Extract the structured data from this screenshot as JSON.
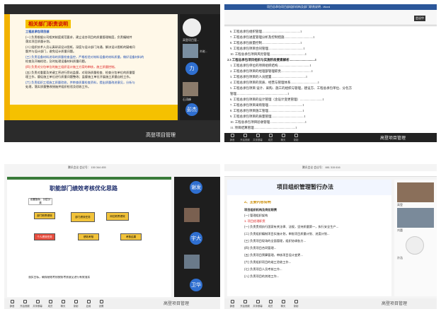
{
  "q1": {
    "title": "相关部门职责说明",
    "subtitle": "工程总承包项目部",
    "lines": [
      "(一) 负责根据公司相关制度规范要求，建立适合项目的质量管理制度，负责编制并",
      "落实项目质量计划。",
      "(二) 组织技术人员认真研读设计图纸，深度与设计部门沟通，解决设计图纸的疑难问",
      "题并与设计部门，避免设计质量问题。",
      "(三) 负责设备材料进场的质量检查监控，严格检验对材料设备的材料质量，做好设备材料的",
      "检查及开箱检验，及时处理设备材料质量问题。",
      "(四) 负责对分包单位的施工组织设计施工方案的审核，施工质量控制。",
      "(五) 负责对重要及关键工序进行旁站监督，对现场质量检查、检查分包单位的质量管",
      "理工作，督促施工单位进行质量问题整改；监督施工单位开展施工质量自检工作。",
      "(六) 负责组织工程施工质量验收，并审查质量检查资料，提出质量改进意见，分析与",
      "处理，落实质量整改措施并组织检验及验收工作。"
    ],
    "watermark": "高登项目管理",
    "side_labels": [
      "高登项目管...",
      "刘老...",
      "力",
      "石涛峰",
      "彭杰"
    ]
  },
  "q2": {
    "window_title": "项目总承包项目部组织机构及部门职责说明 - Word",
    "side_label": "会议中",
    "lines": [
      "6. 工程总承包组织管理................................................1",
      "7. 工程总承包进度管理分析及控制措施....................................1",
      "8. 工程总承包质量控制................................................1",
      "9. 工程总承包项目合同管理............................................1",
      "10. 工程总承包项目风险管理............................................1",
      "2.3 工程总承包项目组织与实施阶段要素解析................................1",
      "1. 工程总承包单位的项目组织结构........................................1",
      "2. 工程总承包项目的经理部管理职责......................................1",
      "3. 工程总承包项目的人员配置...........................................1",
      "4. 工程总承包项目的资质、经营与管理体系..................................1",
      "5. 工程总承包项目 设计、采购、施工的组织与管理，建设方、工程总承包单位、分包方",
      "管理................................................................1",
      "6. 工程总承包项目的设计管理（含设计变更管理）............................1",
      "7. 工程总承包项目采购管理...........................................1",
      "8. 工程总承包项目施工管理...........................................1",
      "9. 工程总承包项目的质量管理.........................................1",
      "10. 工程总承包项目验收管理............................................1",
      "11. 项目结算管理....................................................1",
      "三. 项目总承包项目合同管理策略....................................1"
    ],
    "watermark": "高登项目管理"
  },
  "q3": {
    "meeting_id": "腾讯会议 会议号： 150 344 455",
    "title": "职能部门绩效考核优化思路",
    "boxes": [
      "设置指标，分层分类",
      "部门职责绩效",
      "部门绩效任务",
      "岗位职责绩效",
      "个人绩效任务",
      "绩效考核",
      "考核结果"
    ],
    "bottom_note": "落实目标，确保绩效考核按照考核意见进行有效落实",
    "watermark": "高登项目管理",
    "side_labels": [
      "谢发",
      "俞杰",
      "宇大",
      "赵武",
      "卫华"
    ]
  },
  "q4": {
    "meeting_id": "腾讯会议 会议号： 881 315 616",
    "title": "项目组织管理暂行办法",
    "section": "2、主要内容说明",
    "lines": [
      "项目组织机构及岗位职责",
      "(一) 管理组织架构",
      "1. 项目经理职责",
      "(一) 负责贯彻执行国家有关法律、法规，坚持质量第一，执行安全生产...",
      "(二) 负责组织编制项目实施计划，审批项目质量计划、进度计划...",
      "(三) 负责项目现场的全面管理，组织协调各方...",
      "(四) 负责项目合同管理...",
      "(五) 负责项目预算管理，审核项目设计变更...",
      "(六) 负责组织项目的竣工验收工作...",
      "(七) 负责项目人员考核工作...",
      "(八) 负责项目的其他工作..."
    ],
    "watermark": "高登项目管理",
    "side_labels": [
      "高登",
      "刘蕾",
      "孙浩"
    ]
  },
  "toolbar": [
    "静音",
    "开启视频",
    "共享屏幕",
    "成员",
    "聊天",
    "录制",
    "应用",
    "设置"
  ]
}
